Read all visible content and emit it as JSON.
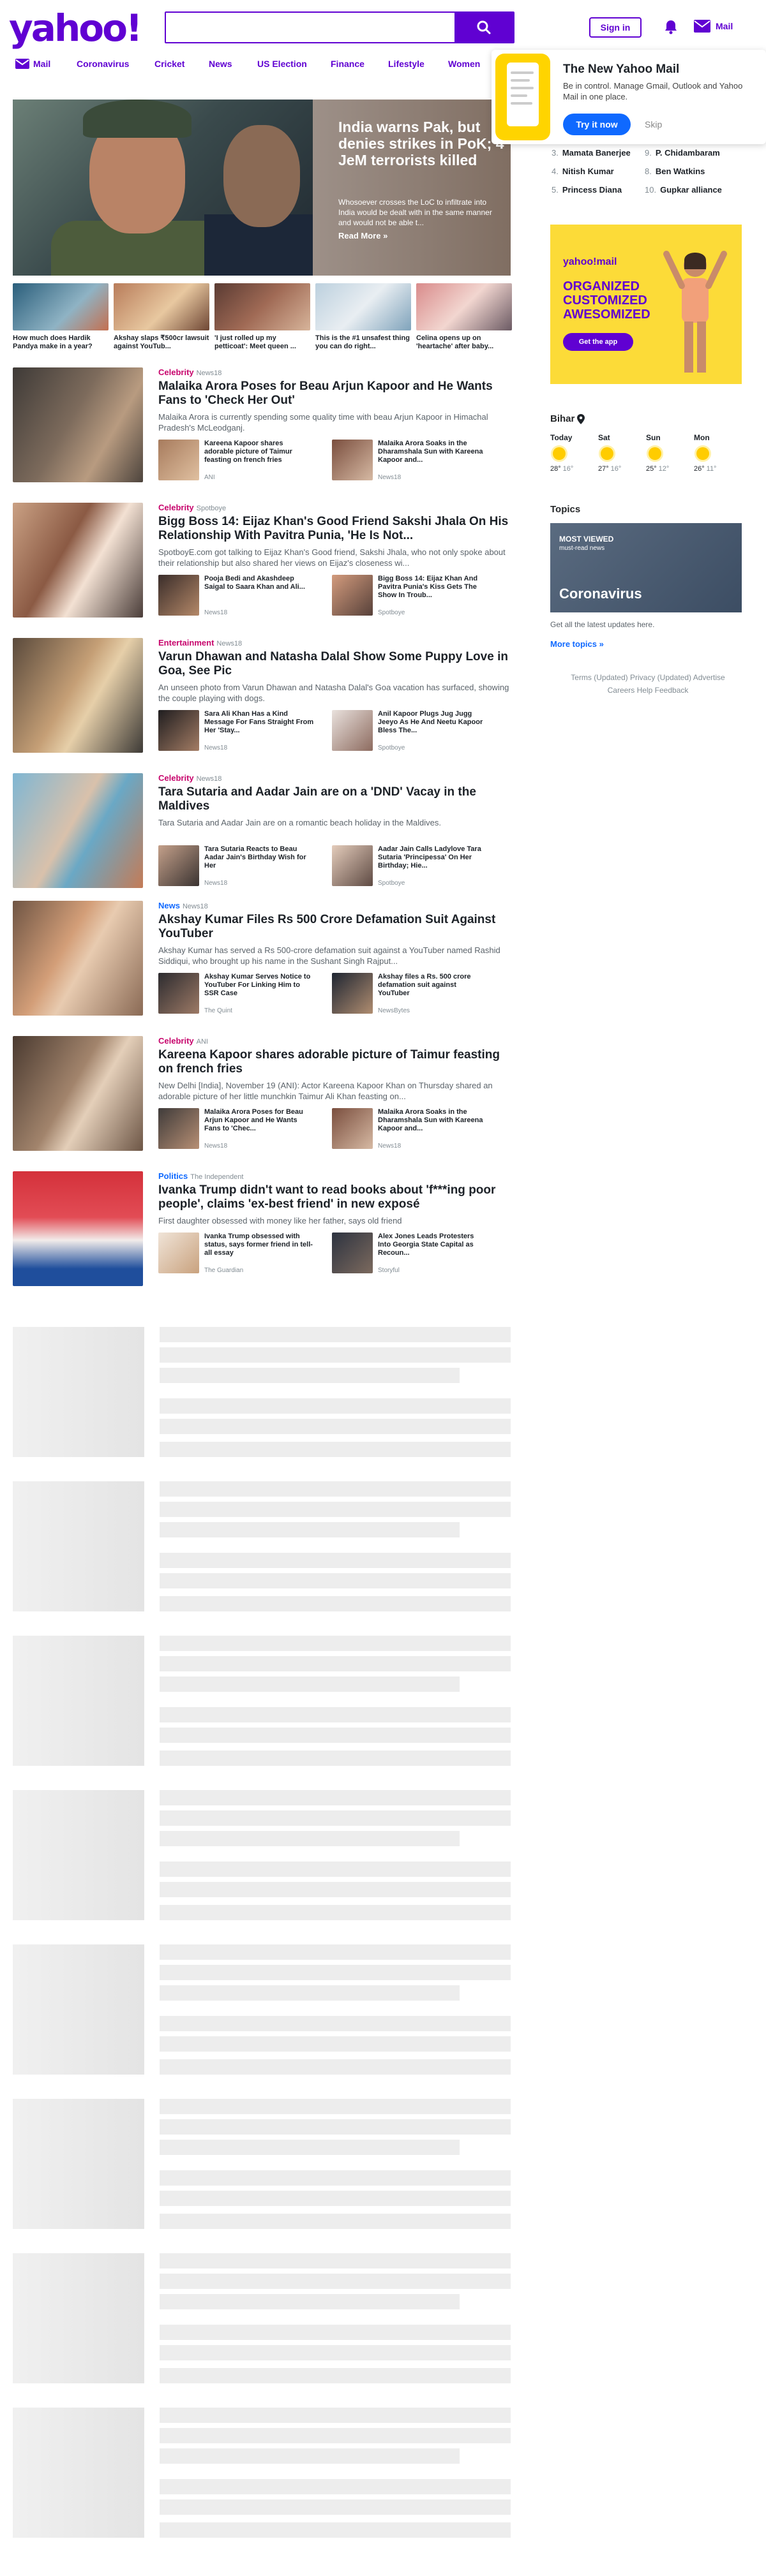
{
  "header": {
    "logo": "yahoo!",
    "search_placeholder": "",
    "signin_label": "Sign in",
    "mail_label": "Mail"
  },
  "nav": {
    "items": [
      "Mail",
      "Coronavirus",
      "Cricket",
      "News",
      "US Election",
      "Finance",
      "Lifestyle",
      "Women"
    ]
  },
  "mail_popup": {
    "title": "The New Yahoo Mail",
    "text": "Be in control. Manage Gmail, Outlook and Yahoo Mail in one place.",
    "try_label": "Try it now",
    "skip_label": "Skip"
  },
  "hero": {
    "title": "India warns Pak, but denies strikes in PoK; 4 JeM terrorists killed",
    "summary": "Whosoever crosses the LoC to infiltrate into India would be dealt with in the same manner and would not be able t...",
    "read_more": "Read More »"
  },
  "strip": [
    {
      "caption": "How much does Hardik Pandya make in a year?"
    },
    {
      "caption": "Akshay slaps ₹500cr lawsuit against YouTub..."
    },
    {
      "caption": "'I just rolled up my petticoat': Meet queen ..."
    },
    {
      "caption": "This is the #1 unsafest thing you can do right..."
    },
    {
      "caption": "Celina opens up on 'heartache' after baby..."
    }
  ],
  "stories": [
    {
      "category": "Celebrity",
      "source": "News18",
      "title": "Malaika Arora Poses for Beau Arjun Kapoor and He Wants Fans to 'Check Her Out'",
      "summary": "Malaika Arora is currently spending some quality time with beau Arjun Kapoor in Himachal Pradesh's McLeodganj.",
      "related": [
        {
          "title": "Kareena Kapoor shares adorable picture of Taimur feasting on french fries",
          "source": "ANI"
        },
        {
          "title": "Malaika Arora Soaks in the Dharamshala Sun with Kareena Kapoor and...",
          "source": "News18"
        }
      ]
    },
    {
      "category": "Celebrity",
      "source": "Spotboye",
      "title": "Bigg Boss 14: Eijaz Khan's Good Friend Sakshi Jhala On His Relationship With Pavitra Punia, 'He Is Not...",
      "summary": "SpotboyE.com got talking to Eijaz Khan's Good friend, Sakshi Jhala, who not only spoke about their relationship but also shared her views on Eijaz's closeness wi...",
      "related": [
        {
          "title": "Pooja Bedi and Akashdeep Saigal to Saara Khan and Ali...",
          "source": "News18"
        },
        {
          "title": "Bigg Boss 14: Eijaz Khan And Pavitra Punia's Kiss Gets The Show In Troub...",
          "source": "Spotboye"
        }
      ]
    },
    {
      "category": "Entertainment",
      "source": "News18",
      "title": "Varun Dhawan and Natasha Dalal Show Some Puppy Love in Goa, See Pic",
      "summary": "An unseen photo from Varun Dhawan and Natasha Dalal's Goa vacation has surfaced, showing the couple playing with dogs.",
      "related": [
        {
          "title": "Sara Ali Khan Has a Kind Message For Fans Straight From Her 'Stay...",
          "source": "News18"
        },
        {
          "title": "Anil Kapoor Plugs Jug Jugg Jeeyo As He And Neetu Kapoor Bless The...",
          "source": "Spotboye"
        }
      ]
    },
    {
      "category": "Celebrity",
      "source": "News18",
      "title": "Tara Sutaria and Aadar Jain are on a 'DND' Vacay in the Maldives",
      "summary": "Tara Sutaria and Aadar Jain are on a romantic beach holiday in the Maldives.",
      "related": [
        {
          "title": "Tara Sutaria Reacts to Beau Aadar Jain's Birthday Wish for Her",
          "source": "News18"
        },
        {
          "title": "Aadar Jain Calls Ladylove Tara Sutaria 'Principessa' On Her Birthday; Hie...",
          "source": "Spotboye"
        }
      ]
    },
    {
      "category": "News",
      "source": "News18",
      "title": "Akshay Kumar Files Rs 500 Crore Defamation Suit Against YouTuber",
      "summary": "Akshay Kumar has served a Rs 500-crore defamation suit against a YouTuber named Rashid Siddiqui, who brought up his name in the Sushant Singh Rajput...",
      "related": [
        {
          "title": "Akshay Kumar Serves Notice to YouTuber For Linking Him to SSR Case",
          "source": "The Quint"
        },
        {
          "title": "Akshay files a Rs. 500 crore defamation suit against YouTuber",
          "source": "NewsBytes"
        }
      ]
    },
    {
      "category": "Celebrity",
      "source": "ANI",
      "title": "Kareena Kapoor shares adorable picture of Taimur feasting on french fries",
      "summary": "New Delhi [India], November 19 (ANI): Actor Kareena Kapoor Khan on Thursday shared an adorable picture of her little munchkin Taimur Ali Khan feasting on...",
      "related": [
        {
          "title": "Malaika Arora Poses for Beau Arjun Kapoor and He Wants Fans to 'Chec...",
          "source": "News18"
        },
        {
          "title": "Malaika Arora Soaks in the Dharamshala Sun with Kareena Kapoor and...",
          "source": "News18"
        }
      ]
    },
    {
      "category": "Politics",
      "source": "The Independent",
      "title": "Ivanka Trump didn't want to read books about 'f***ing poor people', claims 'ex-best friend' in new exposé",
      "summary": "First daughter obsessed with money like her father, says old friend",
      "related": [
        {
          "title": "Ivanka Trump obsessed with status, says former friend in tell-all essay",
          "source": "The Guardian"
        },
        {
          "title": "Alex Jones Leads Protesters Into Georgia State Capital as Recoun...",
          "source": "Storyful"
        }
      ]
    }
  ],
  "trending": [
    {
      "n": "3.",
      "name": "Mamata Banerjee"
    },
    {
      "n": "9.",
      "name": "P. Chidambaram"
    },
    {
      "n": "4.",
      "name": "Nitish Kumar"
    },
    {
      "n": "8.",
      "name": "Ben Watkins"
    },
    {
      "n": "5.",
      "name": "Princess Diana"
    },
    {
      "n": "10.",
      "name": "Gupkar alliance"
    }
  ],
  "ad": {
    "logo": "yahoo!mail",
    "headline": "ORGANIZED CUSTOMIZED AWESOMIZED",
    "button": "Get the app"
  },
  "weather": {
    "location": "Bihar",
    "days": [
      {
        "name": "Today",
        "hi": "28°",
        "lo": "16°"
      },
      {
        "name": "Sat",
        "hi": "27°",
        "lo": "16°"
      },
      {
        "name": "Sun",
        "hi": "25°",
        "lo": "12°"
      },
      {
        "name": "Mon",
        "hi": "26°",
        "lo": "11°"
      }
    ]
  },
  "topics": {
    "heading": "Topics",
    "most_viewed": "MOST VIEWED",
    "most_viewed_sub": "must-read news",
    "name": "Coronavirus",
    "desc": "Get all the latest updates here.",
    "more": "More topics »"
  },
  "footer": {
    "links": [
      "Terms (Updated)",
      "Privacy (Updated)",
      "Advertise",
      "Careers",
      "Help",
      "Feedback"
    ]
  },
  "colors": {
    "brand": "#6001d2",
    "celebrity": "#c7046c",
    "news": "#0f69ff"
  }
}
